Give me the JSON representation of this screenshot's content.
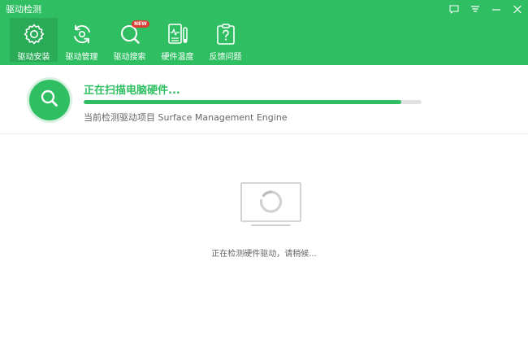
{
  "window": {
    "title": "驱动检测"
  },
  "nav": {
    "items": [
      {
        "label": "驱动安装",
        "icon": "gear-icon",
        "active": true
      },
      {
        "label": "驱动管理",
        "icon": "refresh-icon"
      },
      {
        "label": "驱动搜索",
        "icon": "search-icon",
        "badge": "NEW"
      },
      {
        "label": "硬件温度",
        "icon": "hardware-monitor-icon"
      },
      {
        "label": "反馈问题",
        "icon": "help-icon"
      }
    ]
  },
  "scan": {
    "title": "正在扫描电脑硬件...",
    "progress_percent": 94,
    "current_item": "当前检测驱动项目 Surface Management Engine"
  },
  "status": {
    "message": "正在检测硬件驱动，请稍候..."
  },
  "colors": {
    "accent": "#2fbf62",
    "badge": "#e03a35"
  }
}
